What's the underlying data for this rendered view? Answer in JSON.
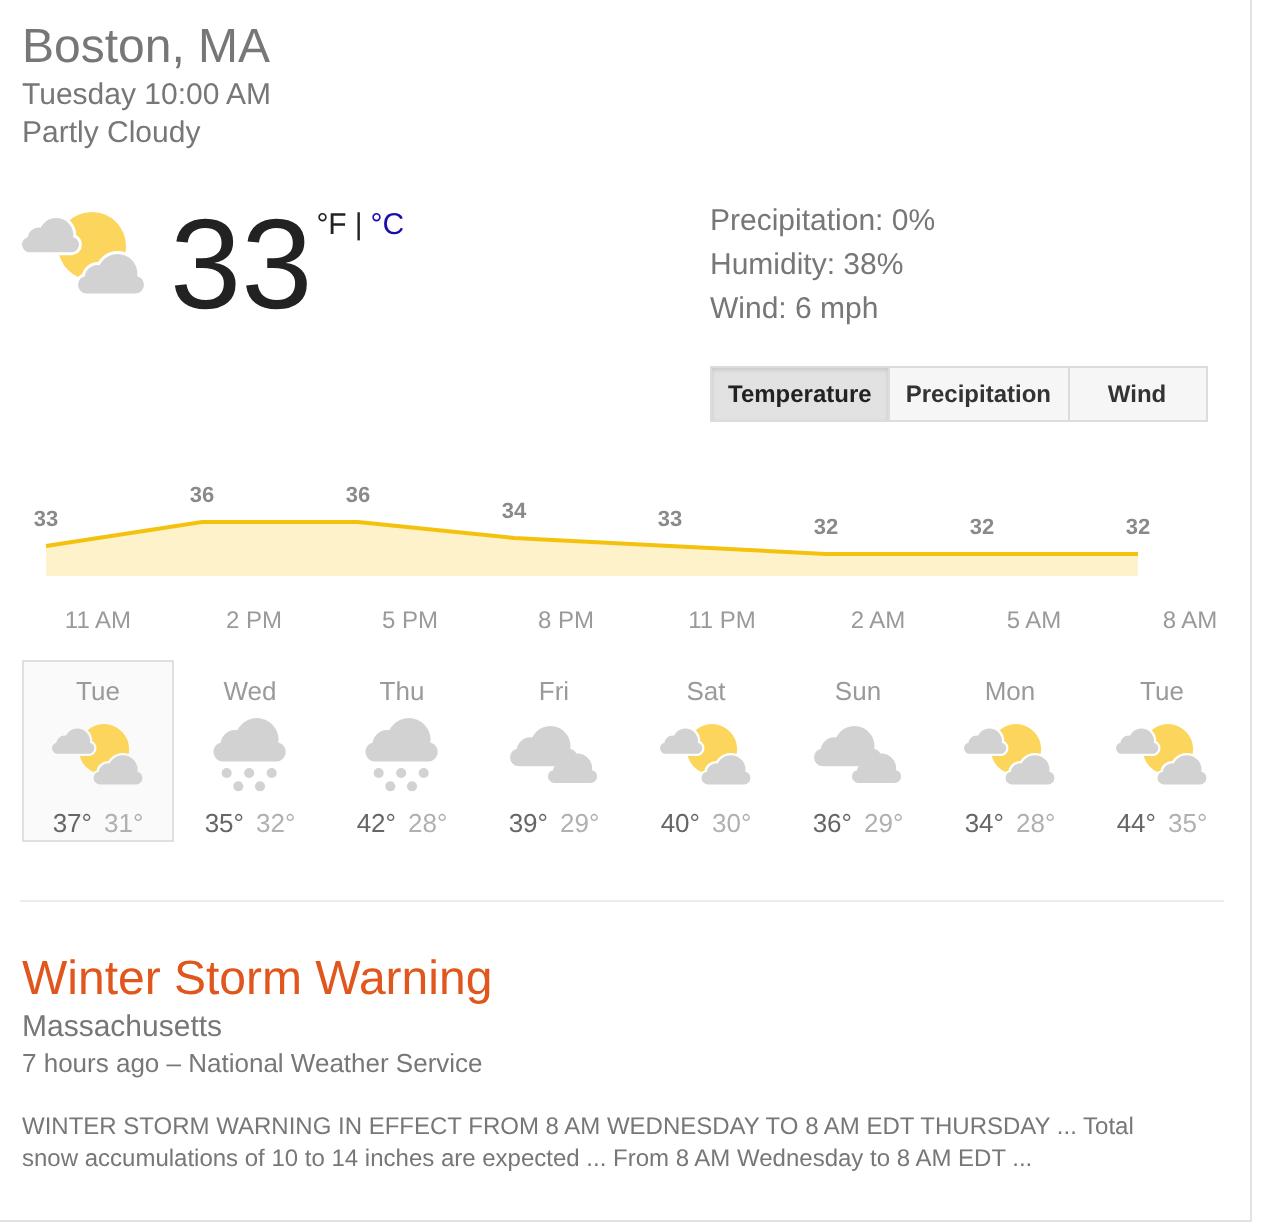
{
  "header": {
    "location": "Boston, MA",
    "datetime": "Tuesday 10:00 AM",
    "condition": "Partly Cloudy"
  },
  "current": {
    "icon": {
      "kind": "partly_cloudy"
    },
    "temperature": "33",
    "units": [
      {
        "label": "°F",
        "selected": true
      },
      {
        "label": "°C",
        "selected": false
      }
    ],
    "separator": "|"
  },
  "details": [
    "Precipitation: 0%",
    "Humidity: 38%",
    "Wind: 6 mph"
  ],
  "tabs": [
    {
      "label": "Temperature",
      "selected": true
    },
    {
      "label": "Precipitation",
      "selected": false
    },
    {
      "label": "Wind",
      "selected": false
    }
  ],
  "hourly": {
    "chart_data": {
      "type": "area",
      "categories": [
        null,
        "11 AM",
        null,
        null,
        "2 PM",
        null,
        null,
        "5 PM",
        null,
        null,
        "8 PM",
        null,
        null,
        "11 PM",
        null,
        null,
        "2 AM",
        null,
        null,
        "5 AM",
        null,
        null,
        "8 AM",
        null
      ],
      "series": [
        {
          "color": "#f4c20d",
          "values": [
            33,
            null,
            null,
            36,
            null,
            null,
            36,
            null,
            null,
            34,
            null,
            null,
            33,
            null,
            null,
            32,
            null,
            null,
            32,
            null,
            null,
            32,
            null,
            null
          ]
        }
      ],
      "data_labels": true
    }
  },
  "daily": [
    {
      "day": "Tue",
      "kind": "partly_cloudy",
      "high": "37°",
      "low": "31°",
      "selected": true
    },
    {
      "day": "Wed",
      "kind": "snow",
      "high": "35°",
      "low": "32°",
      "selected": false
    },
    {
      "day": "Thu",
      "kind": "snow",
      "high": "42°",
      "low": "28°",
      "selected": false
    },
    {
      "day": "Fri",
      "kind": "cloudy",
      "high": "39°",
      "low": "29°",
      "selected": false
    },
    {
      "day": "Sat",
      "kind": "partly_cloudy",
      "high": "40°",
      "low": "30°",
      "selected": false
    },
    {
      "day": "Sun",
      "kind": "cloudy",
      "high": "36°",
      "low": "29°",
      "selected": false
    },
    {
      "day": "Mon",
      "kind": "partly_cloudy",
      "high": "34°",
      "low": "28°",
      "selected": false
    },
    {
      "day": "Tue",
      "kind": "partly_cloudy",
      "high": "44°",
      "low": "35°",
      "selected": false
    }
  ],
  "alert": {
    "title": "Winter Storm Warning",
    "region": "Massachusetts",
    "source": "7 hours ago – National Weather Service",
    "summary": "WINTER STORM WARNING IN EFFECT FROM 8 AM WEDNESDAY TO 8 AM EDT THURSDAY ... Total snow accumulations of 10 to 14 inches are expected ... From 8 AM Wednesday to 8 AM EDT ..."
  }
}
